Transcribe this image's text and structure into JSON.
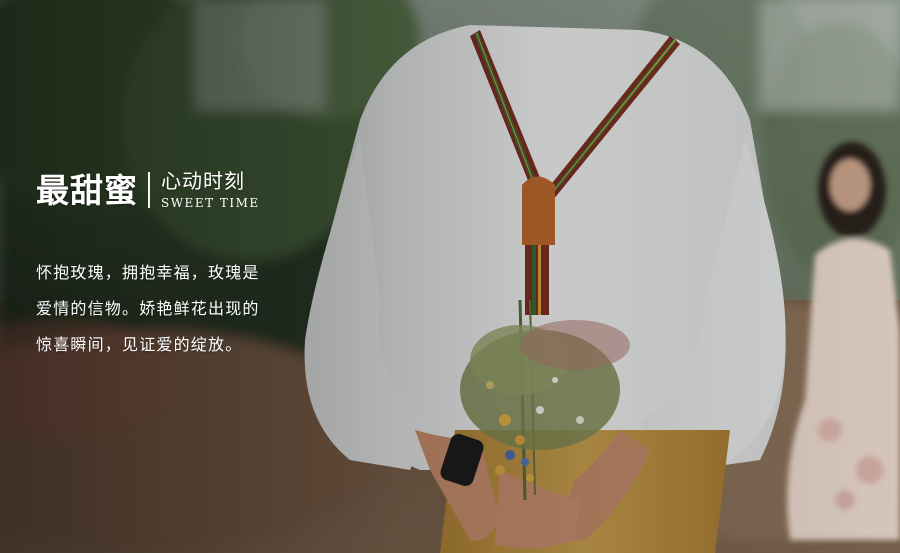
{
  "title": {
    "main": "最甜蜜",
    "sub": "心动时刻",
    "english": "SWEET TIME"
  },
  "body_lines": [
    "怀抱玫瑰，拥抱幸福，玫瑰是",
    "爱情的信物。娇艳鲜花出现的",
    "惊喜瞬间，见证爱的绽放。"
  ],
  "photo": {
    "subject": "man-with-suspenders-holding-bouquet-behind-back",
    "colors": {
      "shirt": "#e9ebea",
      "suspender": "#7e2f22",
      "pants": "#c49a45",
      "foliage": "#4f6b3e",
      "ground": "#7a5f48",
      "dress": "#e8d7cc"
    }
  }
}
